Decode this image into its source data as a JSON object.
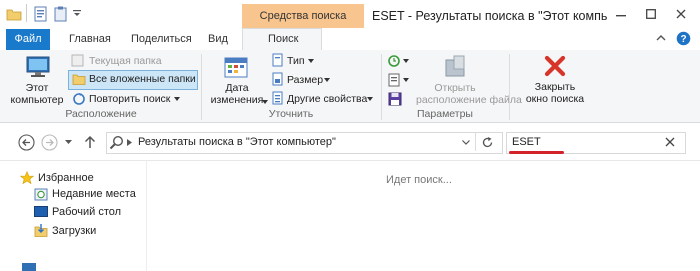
{
  "window": {
    "title": "ESET - Результаты поиска в \"Этот компь",
    "contextual_tab": "Средства поиска"
  },
  "ribbon_tabs": {
    "file": "Файл",
    "home": "Главная",
    "share": "Поделиться",
    "view": "Вид",
    "search": "Поиск"
  },
  "ribbon": {
    "location_group": {
      "this_pc_line1": "Этот",
      "this_pc_line2": "компьютер",
      "current_folder": "Текущая папка",
      "all_subfolders": "Все вложенные папки",
      "search_again": "Повторить поиск",
      "label": "Расположение"
    },
    "refine_group": {
      "date_modified_line1": "Дата",
      "date_modified_line2": "изменения",
      "type": "Тип",
      "size": "Размер",
      "other_properties": "Другие свойства",
      "label": "Уточнить"
    },
    "options_group": {
      "open_location_line1": "Открыть",
      "open_location_line2": "расположение файла",
      "label": "Параметры"
    },
    "close_group": {
      "close_line1": "Закрыть",
      "close_line2": "окно поиска"
    }
  },
  "address_bar": {
    "path": "Результаты поиска в \"Этот компьютер\"",
    "search_value": "ESET"
  },
  "nav_pane": {
    "favorites": "Избранное",
    "recent": "Недавние места",
    "desktop": "Рабочий стол",
    "downloads": "Загрузки"
  },
  "content": {
    "status": "Идет поиск..."
  },
  "colors": {
    "accent_file_tab": "#1979ca",
    "contextual_tab": "#f8c58e",
    "underline_red": "#d4222a"
  }
}
